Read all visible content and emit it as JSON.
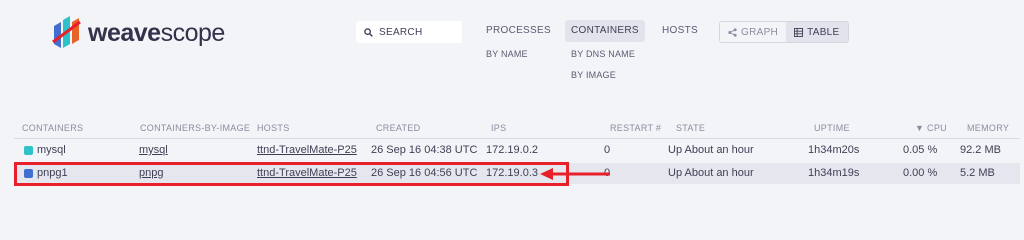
{
  "brand": {
    "name_bold": "weave",
    "name_light": "scope"
  },
  "search": {
    "label": "SEARCH"
  },
  "topologies": [
    {
      "label": "PROCESSES",
      "active": false,
      "subs": [
        "BY NAME"
      ]
    },
    {
      "label": "CONTAINERS",
      "active": true,
      "subs": [
        "BY DNS NAME",
        "BY IMAGE"
      ]
    },
    {
      "label": "HOSTS",
      "active": false,
      "subs": []
    }
  ],
  "view": {
    "graph": "GRAPH",
    "table": "TABLE",
    "active": "table"
  },
  "table": {
    "columns": [
      "CONTAINERS",
      "CONTAINERS-BY-IMAGE",
      "HOSTS",
      "CREATED",
      "IPS",
      "RESTART #",
      "STATE",
      "UPTIME",
      "CPU",
      "MEMORY"
    ],
    "sort_column": "CPU",
    "rows": [
      {
        "color": "#2fc1c9",
        "name": "mysql",
        "image": "mysql",
        "host": "ttnd-TravelMate-P25",
        "created": "26 Sep 16 04:38 UTC",
        "ip": "172.19.0.2",
        "restart": "0",
        "state": "Up About an hour",
        "uptime": "1h34m20s",
        "cpu": "0.05 %",
        "memory": "92.2 MB"
      },
      {
        "color": "#3e6fd1",
        "name": "pnpg1",
        "image": "pnpg",
        "host": "ttnd-TravelMate-P25",
        "created": "26 Sep 16 04:56 UTC",
        "ip": "172.19.0.3",
        "restart": "0",
        "state": "Up About an hour",
        "uptime": "1h34m19s",
        "cpu": "0.00 %",
        "memory": "5.2 MB",
        "highlighted": true
      }
    ]
  },
  "colors": {
    "accent": "#e8202a",
    "background": "#f3f4f8",
    "text": "#3e3f55"
  }
}
